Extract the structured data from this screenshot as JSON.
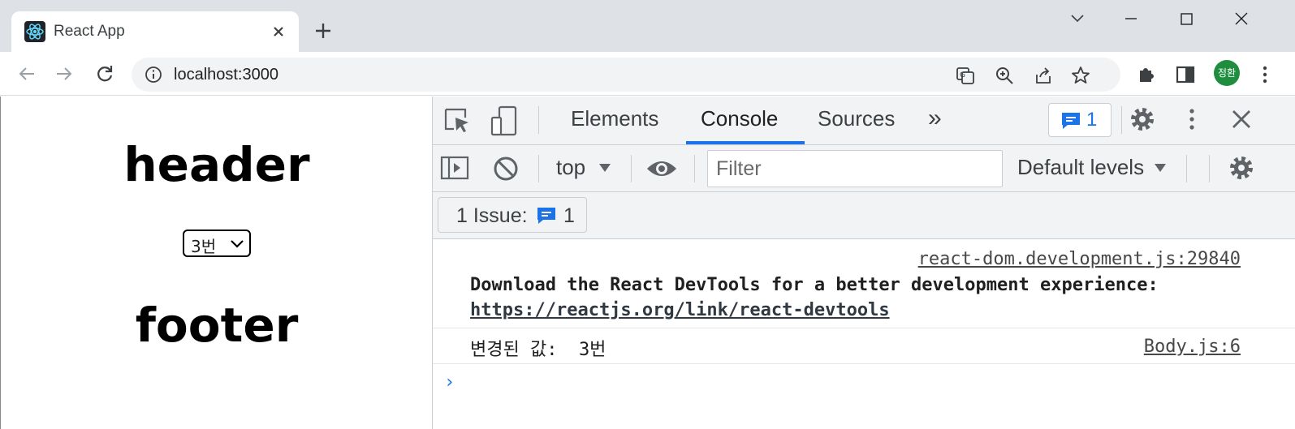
{
  "browser": {
    "tab_title": "React App",
    "url": "localhost:3000",
    "profile_initials": "정환"
  },
  "page": {
    "header": "header",
    "select_value": "3번",
    "footer": "footer"
  },
  "devtools": {
    "tabs": [
      "Elements",
      "Console",
      "Sources"
    ],
    "active_tab": "Console",
    "more_tabs": "»",
    "issue_count": "1",
    "context": "top",
    "filter_placeholder": "Filter",
    "levels": "Default levels",
    "issues_label": "1 Issue:",
    "issues_count": "1",
    "messages": [
      {
        "source": "react-dom.development.js:29840",
        "text": "Download the React DevTools for a better development experience:",
        "link": "https://reactjs.org/link/react-devtools"
      },
      {
        "source": "Body.js:6",
        "text": "변경된 값:  3번"
      }
    ],
    "prompt": "›"
  },
  "colors": {
    "accent": "#1a73e8",
    "tabbar": "#dee1e6",
    "avatar": "#1e8e3e"
  }
}
